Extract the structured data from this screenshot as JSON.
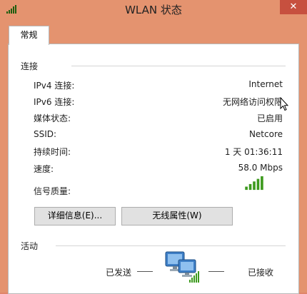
{
  "window": {
    "title": "WLAN 状态",
    "close_glyph": "✕"
  },
  "tabs": [
    {
      "label": "常规"
    }
  ],
  "connection": {
    "section_title": "连接",
    "rows": [
      {
        "label": "IPv4 连接:",
        "value": "Internet"
      },
      {
        "label": "IPv6 连接:",
        "value": "无网络访问权限"
      },
      {
        "label": "媒体状态:",
        "value": "已启用"
      },
      {
        "label": "SSID:",
        "value": "Netcore"
      },
      {
        "label": "持续时间:",
        "value": "1 天 01:36:11"
      },
      {
        "label": "速度:",
        "value": "58.0 Mbps"
      },
      {
        "label": "信号质量:",
        "value": ""
      }
    ],
    "signal_bars": 5,
    "signal_color": "#3d9a1e"
  },
  "buttons": {
    "details": "详细信息(E)...",
    "wireless_props": "无线属性(W)"
  },
  "activity": {
    "section_title": "活动",
    "sent_label": "已发送",
    "received_label": "已接收"
  },
  "colors": {
    "titlebar": "#e4936f",
    "close": "#c7503f"
  }
}
